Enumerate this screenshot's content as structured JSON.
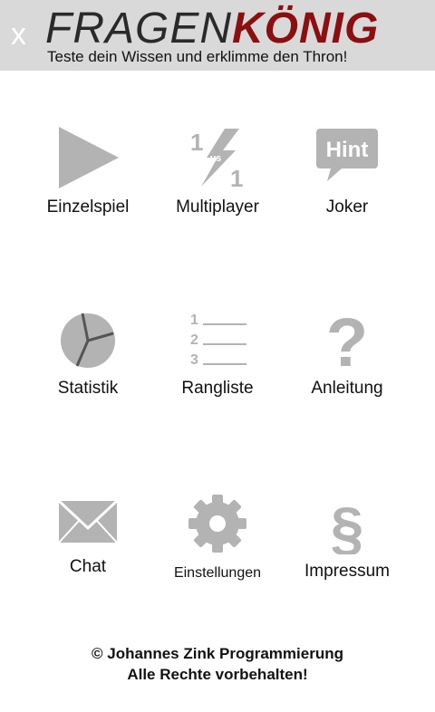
{
  "header": {
    "close_label": "x",
    "title_part1": "FRAGEN",
    "title_part2": "KÖNIG",
    "subtitle": "Teste dein Wissen und erklimme den Thron!"
  },
  "menu": [
    {
      "label": "Einzelspiel",
      "icon": "play-icon"
    },
    {
      "label": "Multiplayer",
      "icon": "versus-lightning-icon"
    },
    {
      "label": "Joker",
      "icon": "hint-bubble-icon"
    },
    {
      "label": "Statistik",
      "icon": "pie-chart-icon"
    },
    {
      "label": "Rangliste",
      "icon": "ranked-list-icon"
    },
    {
      "label": "Anleitung",
      "icon": "question-mark-icon"
    },
    {
      "label": "Chat",
      "icon": "envelope-icon"
    },
    {
      "label": "Einstellungen",
      "icon": "gear-icon"
    },
    {
      "label": "Impressum",
      "icon": "section-sign-icon"
    }
  ],
  "icon_texts": {
    "multiplayer_top": "1",
    "multiplayer_vs": "vs",
    "multiplayer_bottom": "1",
    "hint": "Hint",
    "rank_1": "1",
    "rank_2": "2",
    "rank_3": "3",
    "question": "?",
    "section": "§"
  },
  "footer": {
    "line1": "© Johannes Zink Programmierung",
    "line2": "Alle Rechte vorbehalten!"
  },
  "colors": {
    "header_bg": "#d9d9d9",
    "title_dark": "#2a2a2a",
    "title_accent": "#8b0e10",
    "icon_gray": "#b3b3b3"
  }
}
